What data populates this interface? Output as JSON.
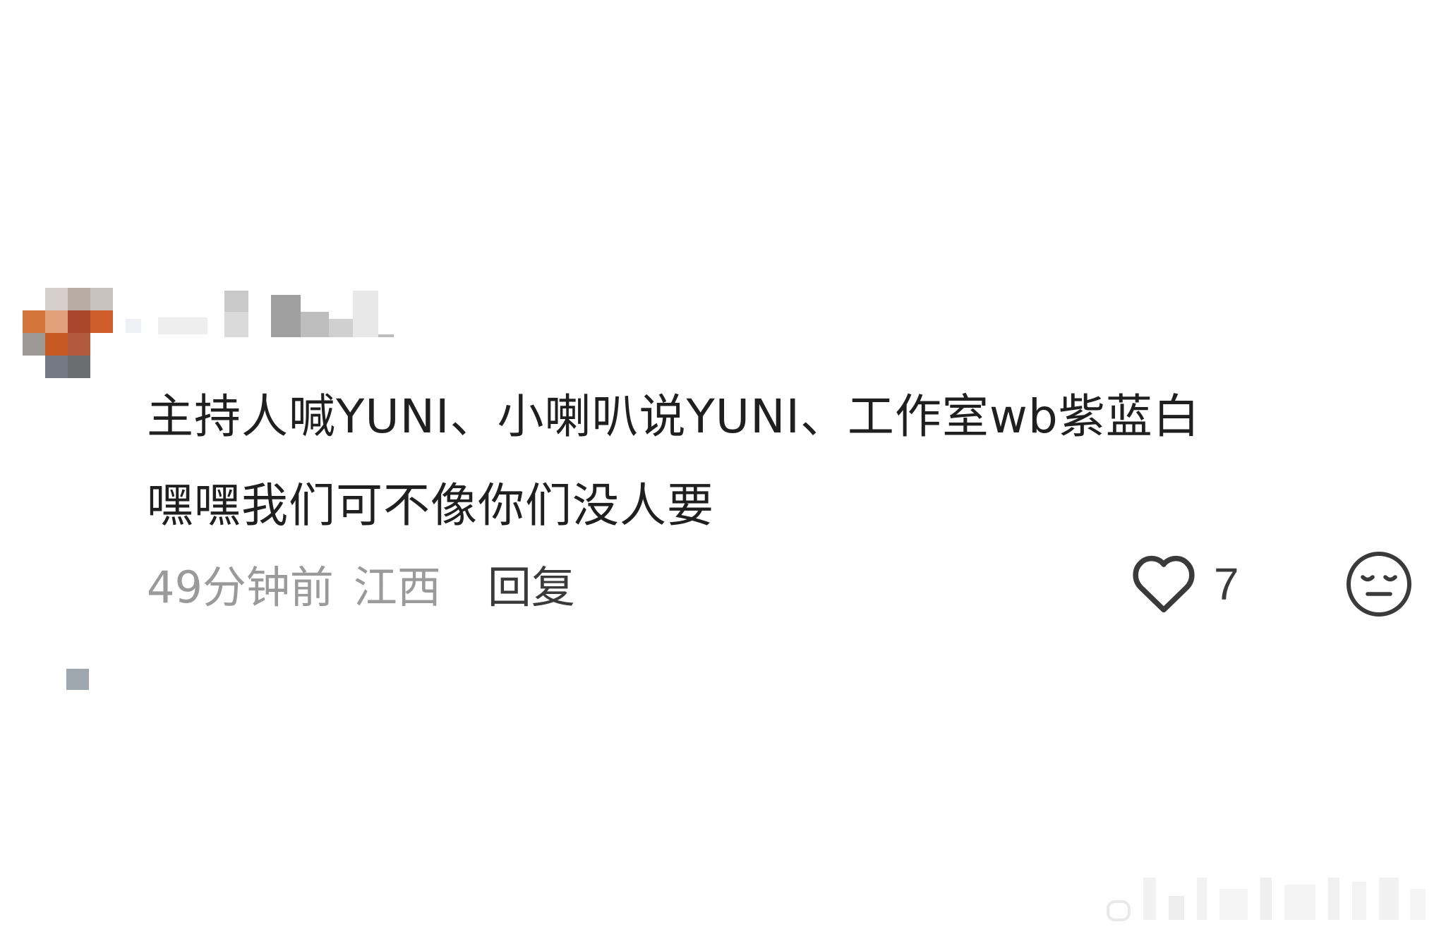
{
  "comment": {
    "lines": [
      "主持人喊YUNI、小喇叭说YUNI、工作室wb紫蓝白",
      "嘿嘿我们可不像你们没人要"
    ],
    "time": "49分钟前",
    "region": "江西",
    "reply_label": "回复",
    "like_count": "7"
  },
  "icons": {
    "like": "heart-outline-icon",
    "dislike": "neutral-face-icon"
  },
  "colors": {
    "text": "#1f1f1f",
    "meta": "#9a9a9a",
    "reply": "#3a3a3a",
    "icon": "#3a3a3a"
  }
}
